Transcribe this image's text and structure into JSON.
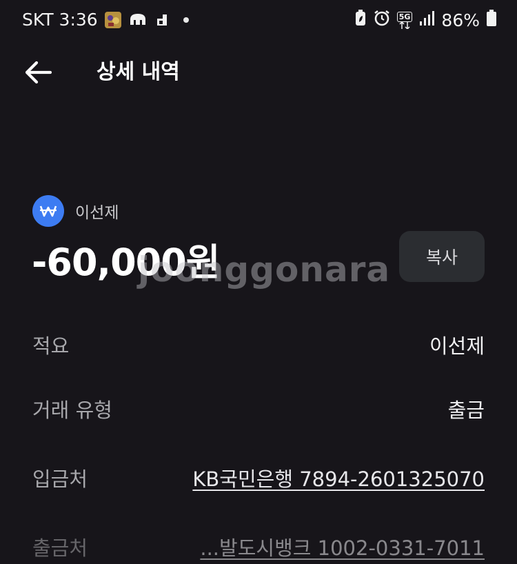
{
  "status_bar": {
    "carrier_time": "SKT 3:36",
    "network": "5G",
    "battery": "86%"
  },
  "header": {
    "title": "상세 내역"
  },
  "transaction": {
    "counterparty": "이선제",
    "amount": "-60,000원",
    "copy_label": "복사"
  },
  "watermark": "joonggonara",
  "details": [
    {
      "label": "적요",
      "value": "이선제"
    },
    {
      "label": "거래 유형",
      "value": "출금"
    },
    {
      "label": "입금처",
      "value": "KB국민은행 7894-2601325070"
    },
    {
      "label": "출금처",
      "value": "...발도시뱅크 1002-0331-7011"
    }
  ],
  "colors": {
    "background": "#17151a",
    "accent_blue": "#3d7cf2",
    "button_bg": "#2b2d31"
  }
}
